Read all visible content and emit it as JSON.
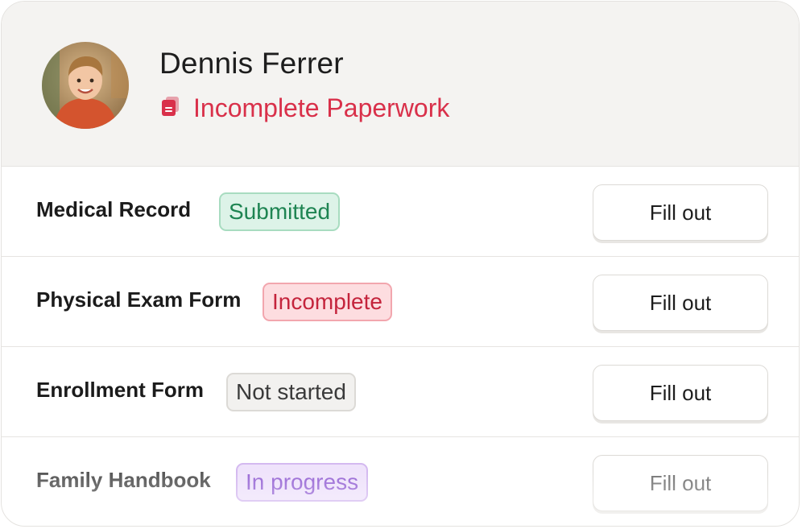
{
  "child": {
    "name": "Dennis Ferrer",
    "status": "Incomplete Paperwork",
    "status_icon": "document-icon",
    "status_color": "#d9304a"
  },
  "forms": [
    {
      "label": "Medical Record",
      "status": "Submitted",
      "action": "Fill out"
    },
    {
      "label": "Physical Exam Form",
      "status": "Incomplete",
      "action": "Fill out"
    },
    {
      "label": "Enrollment Form",
      "status": "Not started",
      "action": "Fill out"
    },
    {
      "label": "Family Handbook",
      "status": "In progress",
      "action": "Fill out"
    }
  ],
  "colors": {
    "submitted": "#1e8452",
    "incomplete": "#c4243c",
    "not_started": "#3a3a3a",
    "in_progress": "#9a6ad6"
  }
}
